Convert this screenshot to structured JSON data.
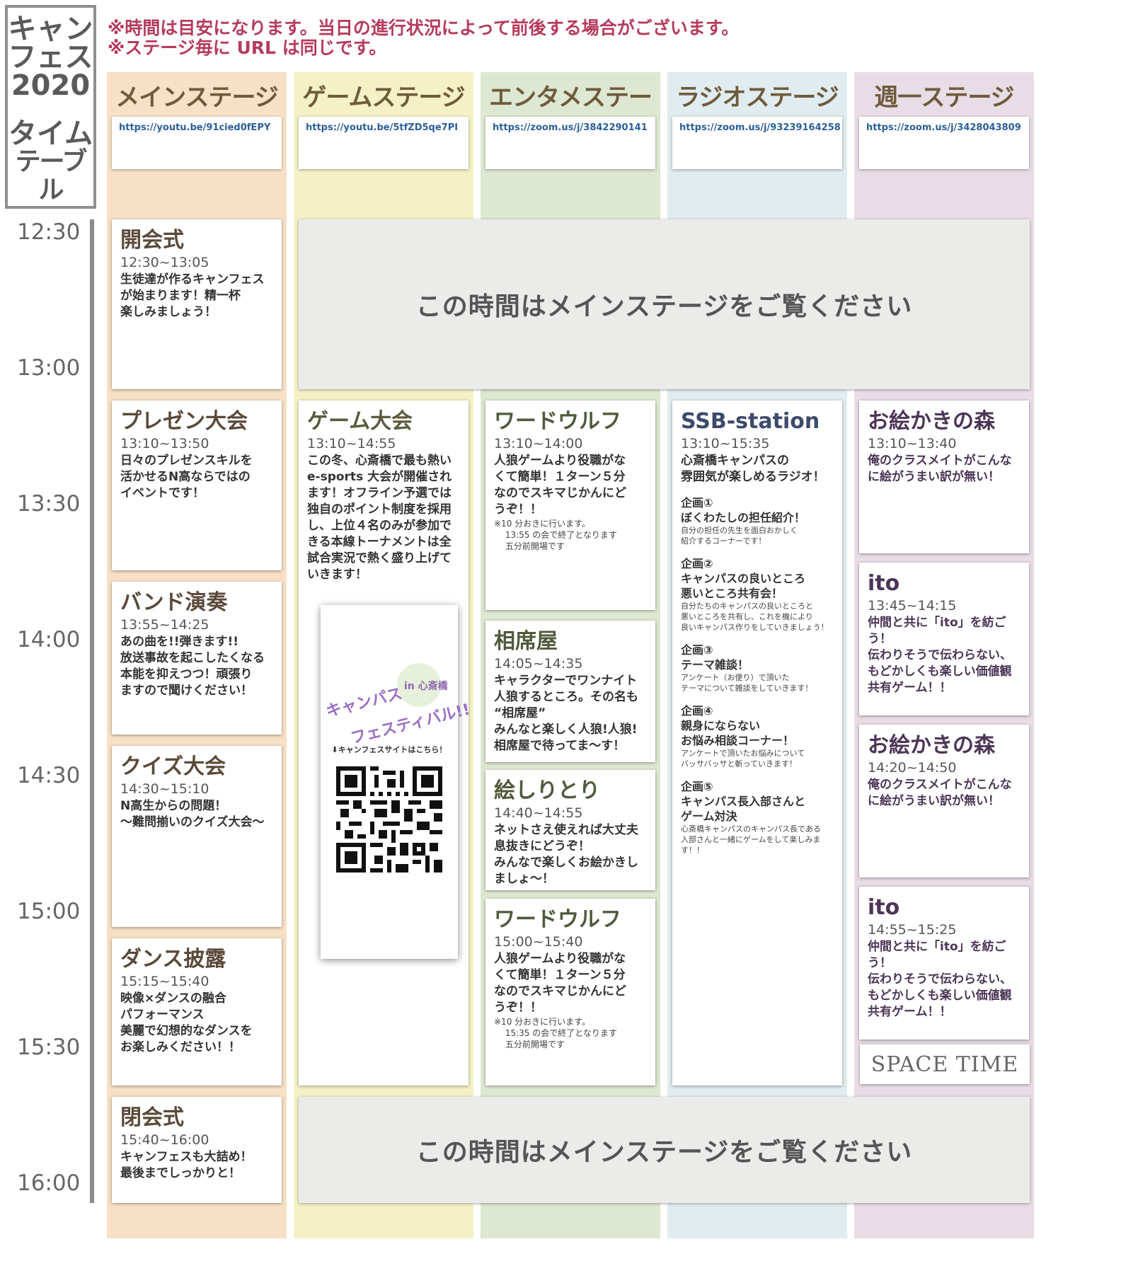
{
  "title": {
    "line1": "キャン",
    "line2": "フェス",
    "line3": "2020",
    "line4": "タイム",
    "line5": "テーブル"
  },
  "notices": [
    "※時間は目安になります。当日の進行状況によって前後する場合がございます。",
    "※ステージ毎に URL は同じです。"
  ],
  "stages": [
    {
      "name": "メインステージ",
      "url": "https://youtu.be/91cied0fEPY"
    },
    {
      "name": "ゲームステージ",
      "url": "https://youtu.be/5tfZD5qe7PI"
    },
    {
      "name": "エンタメステージ",
      "url": "https://zoom.us/j/3842290141"
    },
    {
      "name": "ラジオステージ",
      "url": "https://zoom.us/j/93239164258"
    },
    {
      "name": "週一ステージ",
      "url": "https://zoom.us/j/3428043809"
    }
  ],
  "times": [
    "12:30",
    "13:00",
    "13:30",
    "14:00",
    "14:30",
    "15:00",
    "15:30",
    "16:00"
  ],
  "main_events": [
    {
      "title": "開会式",
      "time": "12:30~13:05",
      "desc": "生徒達が作るキャンフェス\nが始まります！精一杯\n楽しみましょう！"
    },
    {
      "title": "プレゼン大会",
      "time": "13:10~13:50",
      "desc": "日々のプレゼンスキルを\n活かせるN高ならではの\nイベントです！"
    },
    {
      "title": "バンド演奏",
      "time": "13:55~14:25",
      "desc": "あの曲を!!弾きます!!\n放送事故を起こしたくなる\n本能を抑えつつ！頑張り\nますので聞けください！"
    },
    {
      "title": "クイズ大会",
      "time": "14:30~15:10",
      "desc": "N高生からの問題！\n〜難問揃いのクイズ大会〜"
    },
    {
      "title": "ダンス披露",
      "time": "15:15~15:40",
      "desc": "映像×ダンスの融合\nパフォーマンス\n美麗で幻想的なダンスを\nお楽しみください！！"
    },
    {
      "title": "閉会式",
      "time": "15:40~16:00",
      "desc": "キャンフェスも大詰め！\n最後までしっかりと！"
    }
  ],
  "gray_band_text": "この時間はメインステージをご覧ください",
  "game_event": {
    "title": "ゲーム大会",
    "time": "13:10~14:55",
    "desc": "この冬、心斎橋で最も熱い\ne-sports 大会が開催され\nます！オフライン予選では\n独自のポイント制度を採用\nし、上位４名のみが参加で\nきる本線トーナメントは全\n試合実況で熱く盛り上げて\nいきます！"
  },
  "poster": {
    "logo_small": "in 心斎橋",
    "logo_line1": "キャンパス",
    "logo_line2": "フェスティバル!!",
    "caption": "⬇キャンフェスサイトはこちら！"
  },
  "enta_events": [
    {
      "title": "ワードウルフ",
      "time": "13:10~14:00",
      "desc": "人狼ゲームより役職がな\nくて簡単！１ターン５分\nなのでスキマじかんにど\nうぞ！！",
      "note": "※10 分おきに行います。\n　 13:55 の会で終了となります\n　 五分前開場です"
    },
    {
      "title": "相席屋",
      "time": "14:05~14:35",
      "desc": "キャラクターでワンナイト\n人狼するところ。その名も\n“相席屋”\nみんなと楽しく人狼!人狼!\n相席屋で待ってま〜す！"
    },
    {
      "title": "絵しりとり",
      "time": "14:40~14:55",
      "desc": "ネットさえ使えれば大丈夫\n息抜きにどうぞ！\nみんなで楽しくお絵かきし\nましょ〜！"
    },
    {
      "title": "ワードウルフ",
      "time": "15:00~15:40",
      "desc": "人狼ゲームより役職がな\nくて簡単！１ターン５分\nなのでスキマじかんにど\nうぞ！！",
      "note": "※10 分おきに行います。\n　 15:35 の会で終了となります\n　 五分前開場です"
    }
  ],
  "radio_event": {
    "title": "SSB-station",
    "time": "13:10~15:35",
    "desc": "心斎橋キャンパスの\n雰囲気が楽しめるラジオ！",
    "sections": [
      {
        "head": "企画①",
        "body": "ぼくわたしの担任紹介！",
        "small": "自分の担任の先生を面白おかしく\n紹介するコーナーです！"
      },
      {
        "head": "企画②",
        "body": "キャンパスの良いところ\n悪いところ共有会！",
        "small": "自分たちのキャンパスの良いところと\n悪いところを共有し、これを機により\n良いキャンパス作りをしていきましょう！"
      },
      {
        "head": "企画③",
        "body": "テーマ雑談！",
        "small": "アンケート（お便り）で頂いた\nテーマについて雑談をしていきます！"
      },
      {
        "head": "企画④",
        "body": "親身にならない\nお悩み相談コーナー！",
        "small": "アンケートで頂いたお悩みについて\nバッサバッサと斬っていきます！"
      },
      {
        "head": "企画⑤",
        "body": "キャンパス長入部さんと\nゲーム対決",
        "small": "心斎橋キャンパスのキャンパス長である\n入部さんと一緒にゲームをして楽しみま\nす！！"
      }
    ]
  },
  "week_events": [
    {
      "title": "お絵かきの森",
      "time": "13:10~13:40",
      "desc": "俺のクラスメイトがこんな\nに絵がうまい訳が無い！"
    },
    {
      "title": "ito",
      "time": "13:45~14:15",
      "desc": "仲間と共に「ito」を紡ごう！\n伝わりそうで伝わらない、\nもどかしくも楽しい価値観\n共有ゲーム！！"
    },
    {
      "title": "お絵かきの森",
      "time": "14:20~14:50",
      "desc": "俺のクラスメイトがこんな\nに絵がうまい訳が無い！"
    },
    {
      "title": "ito",
      "time": "14:55~15:25",
      "desc": "仲間と共に「ito」を紡ごう！\n伝わりそうで伝わらない、\nもどかしくも楽しい価値観\n共有ゲーム！！"
    }
  ],
  "space_time": "SPACE TIME"
}
